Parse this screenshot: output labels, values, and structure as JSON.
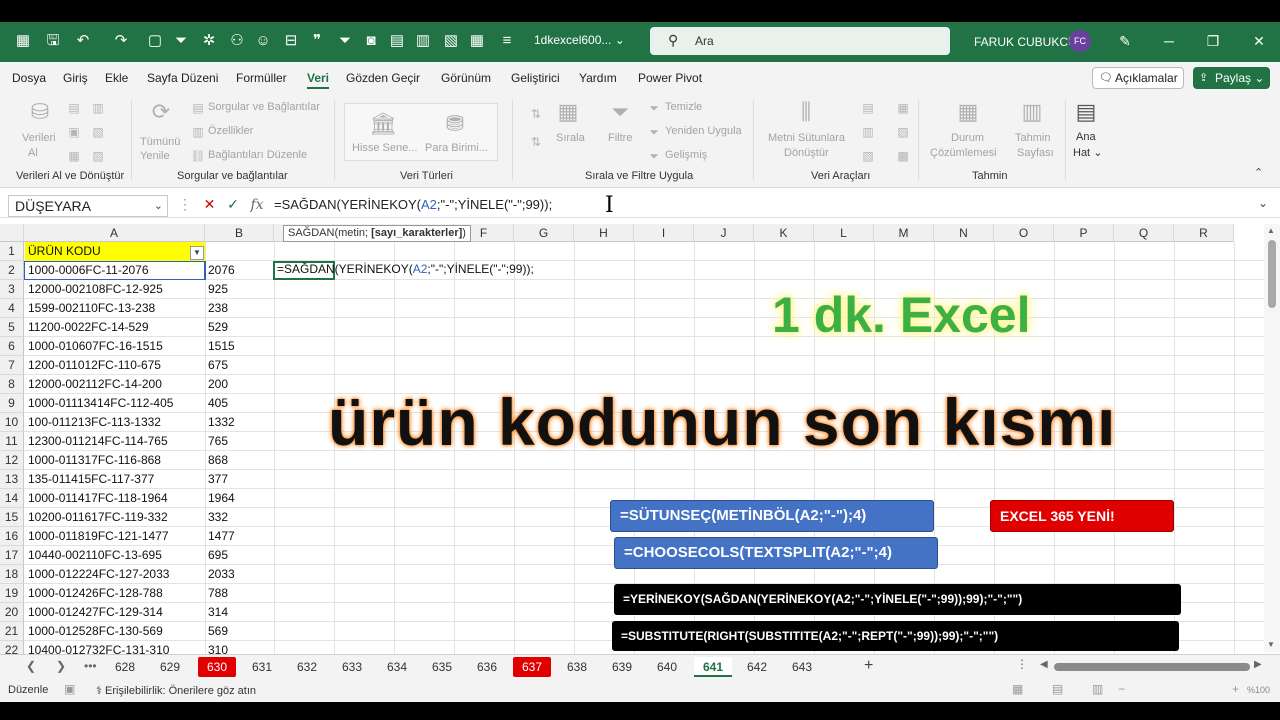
{
  "titlebar": {
    "doc_name": "1dkexcel600...",
    "search_placeholder": "Ara",
    "user_name": "FARUK CUBUKCU",
    "avatar_initials": "FC",
    "accent": "#217346"
  },
  "menu": {
    "items": [
      "Dosya",
      "Giriş",
      "Ekle",
      "Sayfa Düzeni",
      "Formüller",
      "Veri",
      "Gözden Geçir",
      "Görünüm",
      "Geliştirici",
      "Yardım",
      "Power Pivot"
    ],
    "active": "Veri",
    "comments_label": "Açıklamalar",
    "share_label": "Paylaş"
  },
  "ribbon": {
    "get_data": {
      "btn1": "Verileri",
      "btn1b": "Al",
      "group": "Verileri Al ve Dönüştür"
    },
    "queries": {
      "refresh": "Tümünü",
      "refresh_b": "Yenile",
      "item1": "Sorgular ve Bağlantılar",
      "item2": "Özellikler",
      "item3": "Bağlantıları Düzenle",
      "group": "Sorgular ve bağlantılar"
    },
    "datatypes": {
      "stocks": "Hisse Sene...",
      "currency": "Para Birimi...",
      "group": "Veri Türleri"
    },
    "sort": {
      "sort": "Sırala",
      "filter": "Filtre",
      "clear": "Temizle",
      "reapply": "Yeniden Uygula",
      "advanced": "Gelişmiş",
      "group": "Sırala ve Filtre Uygula"
    },
    "tools": {
      "text_to_cols": "Metni Sütunlara",
      "text_to_cols_b": "Dönüştür",
      "group": "Veri Araçları"
    },
    "forecast": {
      "whatif": "Durum",
      "whatif_b": "Çözümlemesi",
      "sheet": "Tahmin",
      "sheet_b": "Sayfası",
      "group": "Tahmin"
    },
    "outline": {
      "label": "Ana",
      "label_b": "Hat"
    }
  },
  "formula_bar": {
    "name_box": "DÜŞEYARA",
    "fx": "fx",
    "formula_prefix": "=SAĞDAN(YERİNEKOY(",
    "formula_ref": "A2",
    "formula_suffix": ";\"-\";YİNELE(\"-\";99));"
  },
  "grid": {
    "columns": [
      "A",
      "B",
      "",
      "",
      "F",
      "G",
      "H",
      "I",
      "J",
      "K",
      "L",
      "M",
      "N",
      "O",
      "P",
      "Q",
      "R"
    ],
    "rows": [
      [
        "ÜRÜN KODU",
        ""
      ],
      [
        "1000-0006FC-11-2076",
        "2076"
      ],
      [
        "12000-002108FC-12-925",
        "925"
      ],
      [
        "1599-002110FC-13-238",
        "238"
      ],
      [
        "11200-0022FC-14-529",
        "529"
      ],
      [
        "1000-010607FC-16-1515",
        "1515"
      ],
      [
        "1200-011012FC-110-675",
        "675"
      ],
      [
        "12000-002112FC-14-200",
        "200"
      ],
      [
        "1000-01113414FC-112-405",
        "405"
      ],
      [
        "100-011213FC-113-1332",
        "1332"
      ],
      [
        "12300-011214FC-114-765",
        "765"
      ],
      [
        "1000-011317FC-116-868",
        "868"
      ],
      [
        "135-011415FC-117-377",
        "377"
      ],
      [
        "1000-011417FC-118-1964",
        "1964"
      ],
      [
        "10200-011617FC-119-332",
        "332"
      ],
      [
        "1000-011819FC-121-1477",
        "1477"
      ],
      [
        "10440-002110FC-13-695",
        "695"
      ],
      [
        "1000-012224FC-127-2033",
        "2033"
      ],
      [
        "1000-012426FC-128-788",
        "788"
      ],
      [
        "1000-012427FC-129-314",
        "314"
      ],
      [
        "1000-012528FC-130-569",
        "569"
      ],
      [
        "10400-012732FC-131-310",
        "310"
      ]
    ],
    "tooltip_fn": "SAĞDAN(metin; ",
    "tooltip_arg": "[sayı_karakterler]",
    "tooltip_end": ")",
    "inline_prefix": "=SAĞDAN(YERİNEKOY(",
    "inline_ref": "A2",
    "inline_suffix": ";\"-\";YİNELE(\"-\";99));",
    "header_fill": "#ffff00"
  },
  "overlay": {
    "title_top": "1 dk. Excel",
    "title_main": "ürün kodunun son kısmı",
    "box1": "=SÜTUNSEÇ(METİNBÖL(A2;\"-\");4)",
    "box2": "=CHOOSECOLS(TEXTSPLIT(A2;\"-\";4)",
    "box365": "EXCEL 365 YENİ!",
    "box3": "=YERİNEKOY(SAĞDAN(YERİNEKOY(A2;\"-\";YİNELE(\"-\";99));99);\"-\";\"\")",
    "box4": "=SUBSTITUTE(RIGHT(SUBSTITITE(A2;\"-\";REPT(\"-\";99));99);\"-\";\"\")"
  },
  "sheets": {
    "tabs": [
      "628",
      "629",
      "630",
      "631",
      "632",
      "633",
      "634",
      "635",
      "636",
      "637",
      "638",
      "639",
      "640",
      "641",
      "642",
      "643"
    ],
    "red_tabs": [
      "630",
      "637"
    ],
    "active": "641",
    "more": "•••"
  },
  "status": {
    "mode": "Düzenle",
    "accessibility": "Erişilebilirlik: Önerilere göz atın",
    "zoom": "%100"
  }
}
